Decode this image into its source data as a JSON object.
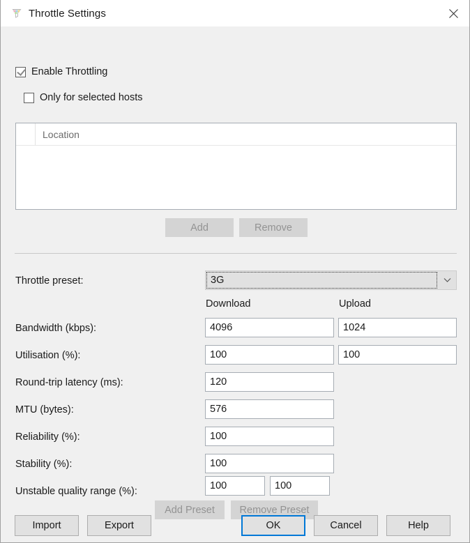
{
  "window": {
    "title": "Throttle Settings",
    "icon": "throttle-app-icon",
    "close_icon": "close-icon"
  },
  "options": {
    "enable_throttling": {
      "label": "Enable Throttling",
      "checked": true
    },
    "only_selected_hosts": {
      "label": "Only for selected hosts",
      "checked": false
    }
  },
  "host_list": {
    "columns": [
      "",
      "Location"
    ],
    "rows": []
  },
  "list_buttons": {
    "add": "Add",
    "remove": "Remove"
  },
  "preset": {
    "label": "Throttle preset:",
    "value": "3G",
    "arrow_icon": "chevron-down-icon"
  },
  "columns": {
    "download": "Download",
    "upload": "Upload"
  },
  "fields": {
    "bandwidth": {
      "label": "Bandwidth (kbps):",
      "download": "4096",
      "upload": "1024"
    },
    "utilisation": {
      "label": "Utilisation (%):",
      "download": "100",
      "upload": "100"
    },
    "latency": {
      "label": "Round-trip latency (ms):",
      "download": "120"
    },
    "mtu": {
      "label": "MTU (bytes):",
      "download": "576"
    },
    "reliability": {
      "label": "Reliability (%):",
      "download": "100"
    },
    "stability": {
      "label": "Stability (%):",
      "download": "100"
    },
    "unstable_range": {
      "label": "Unstable quality range (%):",
      "low": "100",
      "high": "100"
    }
  },
  "preset_buttons": {
    "add_preset": "Add Preset",
    "remove_preset": "Remove Preset"
  },
  "footer": {
    "import": "Import",
    "export": "Export",
    "ok": "OK",
    "cancel": "Cancel",
    "help": "Help"
  },
  "colors": {
    "accent": "#0078d7",
    "dialog_bg": "#f0f0f0",
    "field_bg": "#ffffff",
    "button_bg": "#e1e1e1",
    "disabled_bg": "#d4d4d4",
    "disabled_text": "#939393"
  }
}
